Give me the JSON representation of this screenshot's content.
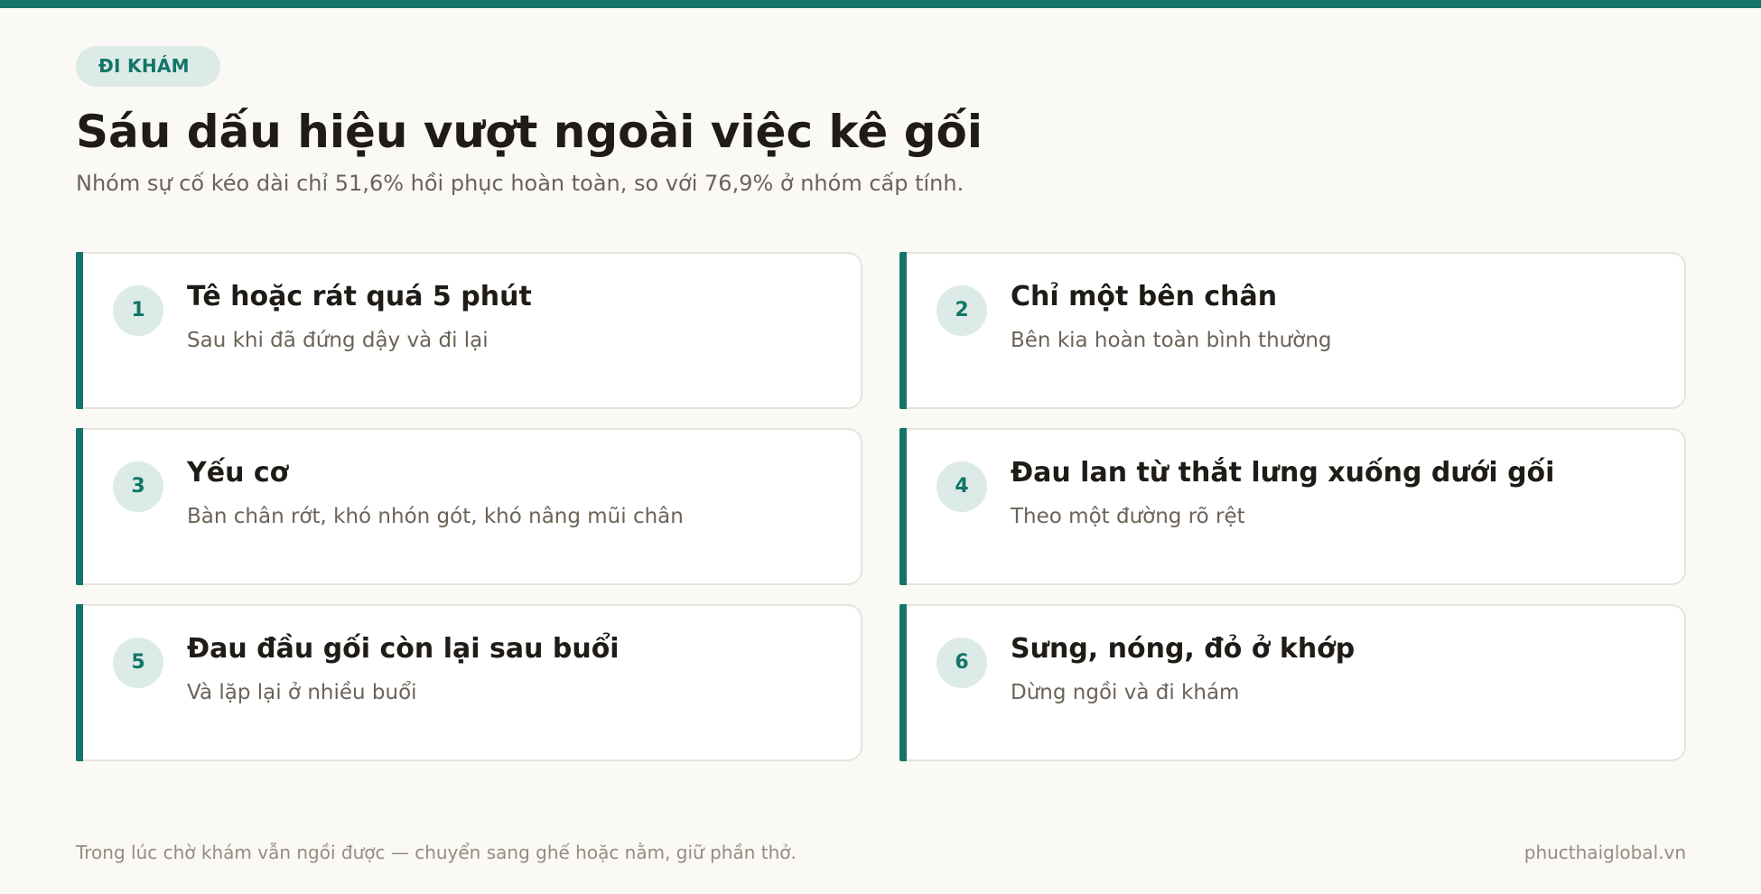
{
  "header": {
    "badge": "ĐI KHÁM",
    "title": "Sáu dấu hiệu vượt ngoài việc kê gối",
    "subtitle": "Nhóm sự cố kéo dài chỉ 51,6% hồi phục hoàn toàn, so với 76,9% ở nhóm cấp tính."
  },
  "signs": [
    {
      "number": "1",
      "title": "Tê hoặc rát quá 5 phút",
      "desc": "Sau khi đã đứng dậy và đi lại"
    },
    {
      "number": "2",
      "title": "Chỉ một bên chân",
      "desc": "Bên kia hoàn toàn bình thường"
    },
    {
      "number": "3",
      "title": "Yếu cơ",
      "desc": "Bàn chân rớt, khó nhón gót, khó nâng mũi chân"
    },
    {
      "number": "4",
      "title": "Đau lan từ thắt lưng xuống dưới gối",
      "desc": "Theo một đường rõ rệt"
    },
    {
      "number": "5",
      "title": "Đau đầu gối còn lại sau buổi",
      "desc": "Và lặp lại ở nhiều buổi"
    },
    {
      "number": "6",
      "title": "Sưng, nóng, đỏ ở khớp",
      "desc": "Dừng ngồi và đi khám"
    }
  ],
  "footer": {
    "note": "Trong lúc chờ khám vẫn ngồi được — chuyển sang ghế hoặc nằm, giữ phần thở.",
    "site": "phucthaiglobal.vn"
  },
  "colors": {
    "accent": "#137569",
    "accent_light": "#dcebe7",
    "background": "#faf9f5",
    "card_border": "#e8e4da"
  }
}
